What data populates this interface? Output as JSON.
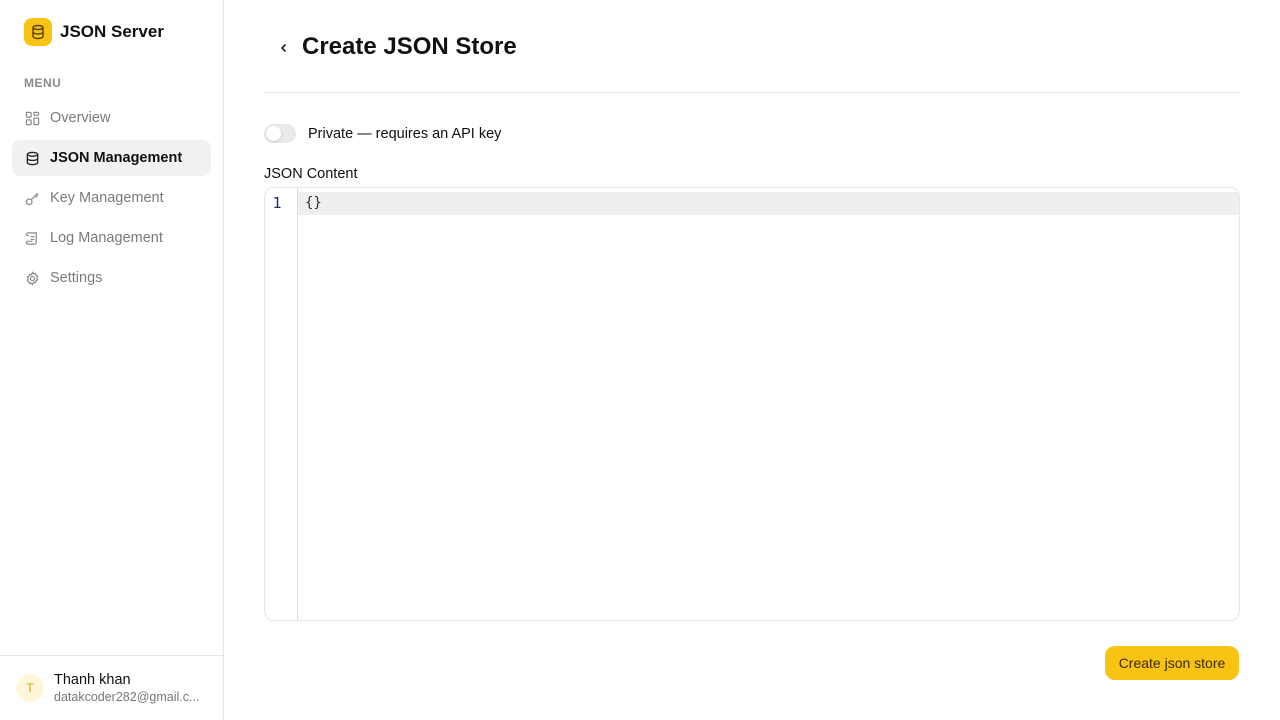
{
  "brand": {
    "name": "JSON Server",
    "logo_icon": "database-icon",
    "accent": "#f8c313"
  },
  "sidebar": {
    "menu_label": "MENU",
    "items": [
      {
        "label": "Overview",
        "icon": "grid-icon",
        "active": false
      },
      {
        "label": "JSON Management",
        "icon": "database-icon",
        "active": true
      },
      {
        "label": "Key Management",
        "icon": "key-icon",
        "active": false
      },
      {
        "label": "Log Management",
        "icon": "scroll-icon",
        "active": false
      },
      {
        "label": "Settings",
        "icon": "gear-icon",
        "active": false
      }
    ]
  },
  "user": {
    "initial": "T",
    "name": "Thanh khan",
    "email": "datakcoder282@gmail.c..."
  },
  "header": {
    "title": "Create JSON Store",
    "back_icon": "chevron-left-icon"
  },
  "form": {
    "private_toggle": {
      "label": "Private — requires an API key",
      "checked": false
    },
    "json_content": {
      "label": "JSON Content",
      "line_numbers": [
        "1"
      ],
      "lines": [
        "{}"
      ]
    },
    "submit_label": "Create json store"
  }
}
